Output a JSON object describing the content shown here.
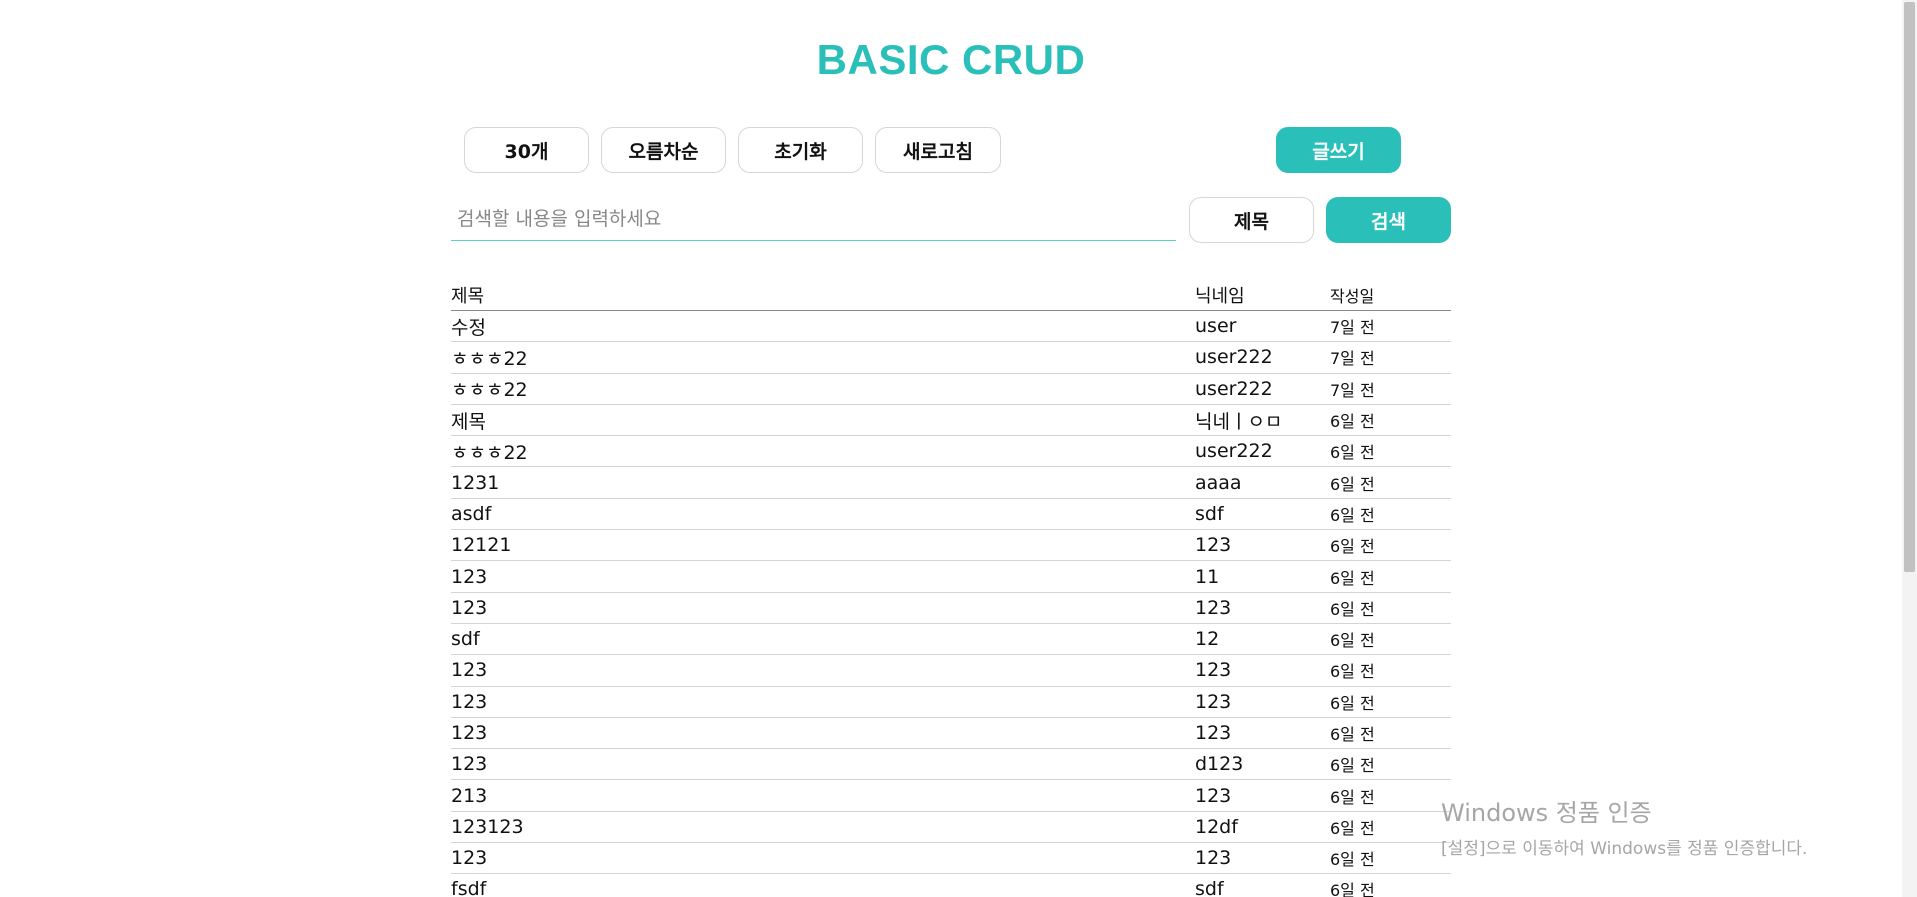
{
  "header": {
    "title": "BASIC CRUD"
  },
  "toolbar": {
    "count_label": "30개",
    "sort_label": "오름차순",
    "reset_label": "초기화",
    "refresh_label": "새로고침",
    "write_label": "글쓰기"
  },
  "search": {
    "placeholder": "검색할 내용을 입력하세요",
    "value": "",
    "field_label": "제목",
    "submit_label": "검색"
  },
  "table": {
    "columns": [
      "제목",
      "닉네임",
      "작성일"
    ],
    "rows": [
      {
        "title": "수정",
        "nickname": "user",
        "date": "7일 전"
      },
      {
        "title": "ㅎㅎㅎ22",
        "nickname": "user222",
        "date": "7일 전"
      },
      {
        "title": "ㅎㅎㅎ22",
        "nickname": "user222",
        "date": "7일 전"
      },
      {
        "title": "제목",
        "nickname": "닉네ㅣㅇㅁ",
        "date": "6일 전"
      },
      {
        "title": "ㅎㅎㅎ22",
        "nickname": "user222",
        "date": "6일 전"
      },
      {
        "title": "1231",
        "nickname": "aaaa",
        "date": "6일 전"
      },
      {
        "title": "asdf",
        "nickname": "sdf",
        "date": "6일 전"
      },
      {
        "title": "12121",
        "nickname": "123",
        "date": "6일 전"
      },
      {
        "title": "123",
        "nickname": "11",
        "date": "6일 전"
      },
      {
        "title": "123",
        "nickname": "123",
        "date": "6일 전"
      },
      {
        "title": "sdf",
        "nickname": "12",
        "date": "6일 전"
      },
      {
        "title": "123",
        "nickname": "123",
        "date": "6일 전"
      },
      {
        "title": "123",
        "nickname": "123",
        "date": "6일 전"
      },
      {
        "title": "123",
        "nickname": "123",
        "date": "6일 전"
      },
      {
        "title": "123",
        "nickname": "d123",
        "date": "6일 전"
      },
      {
        "title": "213",
        "nickname": "123",
        "date": "6일 전"
      },
      {
        "title": "123123",
        "nickname": "12df",
        "date": "6일 전"
      },
      {
        "title": "123",
        "nickname": "123",
        "date": "6일 전"
      },
      {
        "title": "fsdf",
        "nickname": "sdf",
        "date": "6일 전"
      }
    ]
  },
  "watermark": {
    "title": "Windows 정품 인증",
    "subtitle": "[설정]으로 이동하여 Windows를 정품 인증합니다."
  },
  "colors": {
    "accent": "#2bbfba",
    "input_underline": "#5fd0c8"
  }
}
